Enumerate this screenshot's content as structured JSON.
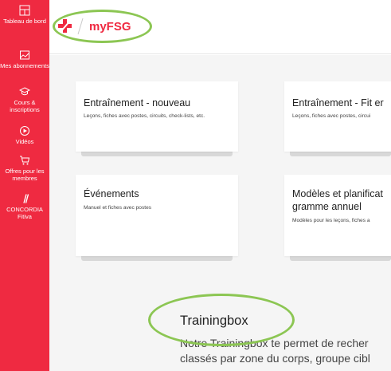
{
  "sidebar": {
    "items": [
      {
        "label": "Tableau de bord",
        "icon": "dashboard-icon"
      },
      {
        "label": "Mes abonnements",
        "icon": "image-icon"
      },
      {
        "label": "Cours & inscriptions",
        "icon": "graduation-cap-icon"
      },
      {
        "label": "Vidéos",
        "icon": "play-icon"
      },
      {
        "label": "Offres pour les membres",
        "icon": "cart-icon"
      },
      {
        "label": "CONCORDIA Fitiva",
        "icon": "slash-icon"
      }
    ]
  },
  "header": {
    "brand": "myFSG"
  },
  "cards": [
    {
      "title": "Entraînement - nouveau",
      "desc": "Leçons, fiches avec postes, circuits, check-lists, etc."
    },
    {
      "title": "Entraînement - Fit er",
      "desc": "Leçons, fiches avec postes, circui"
    },
    {
      "title": "Événements",
      "desc": "Manuel et fiches avec postes"
    },
    {
      "title": "Modèles et planificat",
      "title2": "gramme annuel",
      "desc": "Modèles pour les leçons, fiches a"
    }
  ],
  "trainingbox": {
    "title": "Trainingbox",
    "line1": "Notre Trainingbox te permet de recher",
    "line2": "classés par zone du corps, groupe cibl"
  },
  "colors": {
    "brand": "#ef2a41",
    "highlight": "#8cc653"
  }
}
